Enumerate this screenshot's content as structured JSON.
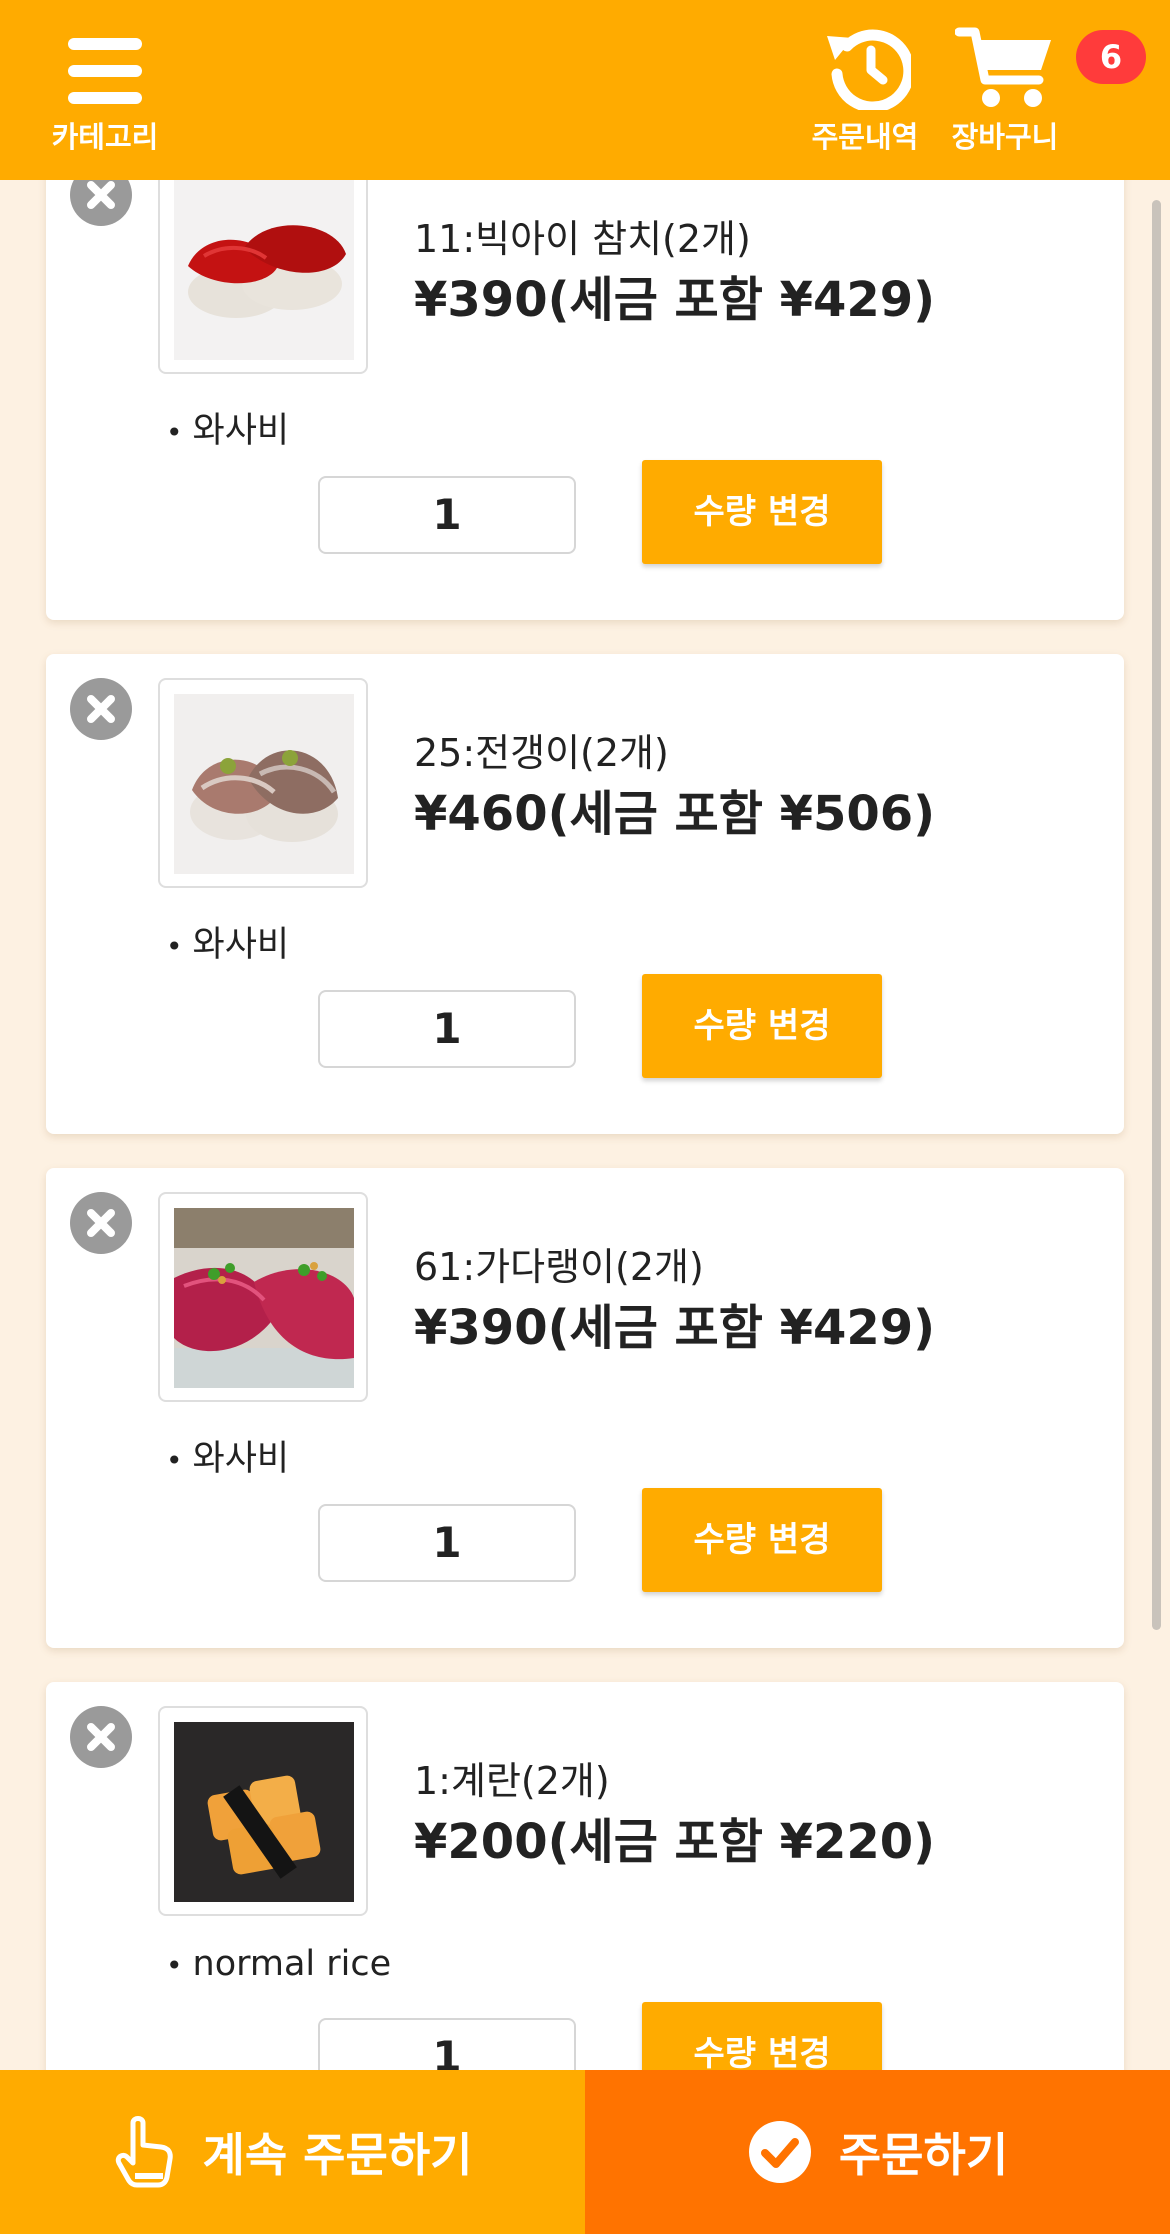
{
  "header": {
    "menu_label": "카테고리",
    "history_label": "주문내역",
    "cart_label": "장바구니",
    "cart_count": "6",
    "bg_color": "#ffab00"
  },
  "items": [
    {
      "name": "11:빅아이 참치(2개)",
      "price": "¥390(세금 포함 ¥429)",
      "option": "와사비",
      "qty": "1",
      "button": "수량 변경"
    },
    {
      "name": "25:전갱이(2개)",
      "price": "¥460(세금 포함 ¥506)",
      "option": "와사비",
      "qty": "1",
      "button": "수량 변경"
    },
    {
      "name": "61:가다랭이(2개)",
      "price": "¥390(세금 포함 ¥429)",
      "option": "와사비",
      "qty": "1",
      "button": "수량 변경"
    },
    {
      "name": "1:계란(2개)",
      "price": "¥200(세금 포함 ¥220)",
      "option": "normal rice",
      "qty": "1",
      "button": "수량 변경"
    }
  ],
  "footer": {
    "continue_label": "계속 주문하기",
    "order_label": "주문하기",
    "continue_color": "#ffab00",
    "order_color": "#ff7300"
  }
}
